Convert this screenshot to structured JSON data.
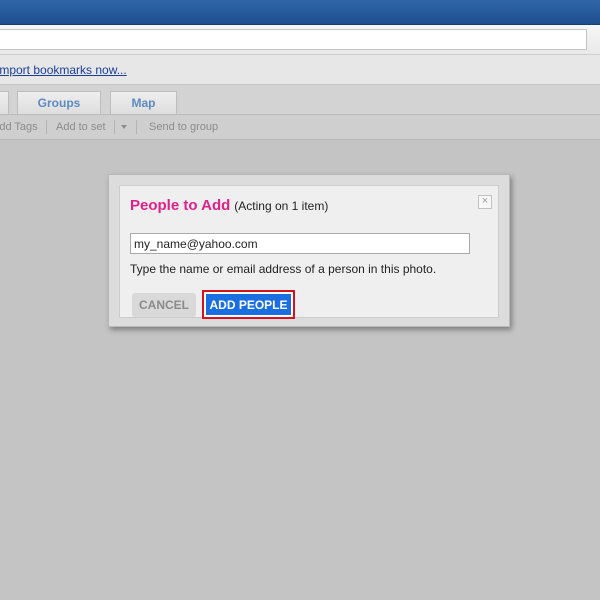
{
  "bookmarks_bar": {
    "import_link": "Import bookmarks now..."
  },
  "tabs": [
    {
      "label": "Groups"
    },
    {
      "label": "Map"
    }
  ],
  "toolbar": {
    "add_tags": "Add Tags",
    "add_to_set": "Add to set",
    "send_to_group": "Send to group"
  },
  "dialog": {
    "title": "People to Add",
    "subtitle": "(Acting on 1 item)",
    "close_glyph": "×",
    "input_value": "my_name@yahoo.com",
    "hint": "Type the name or email address of a person in this photo.",
    "cancel_label": "CANCEL",
    "add_label": "ADD PEOPLE"
  },
  "colors": {
    "title_accent": "#e0218a",
    "primary_button": "#1b6ee0",
    "highlight_outline": "#d8111e",
    "tab_text": "#5d8ac2"
  }
}
